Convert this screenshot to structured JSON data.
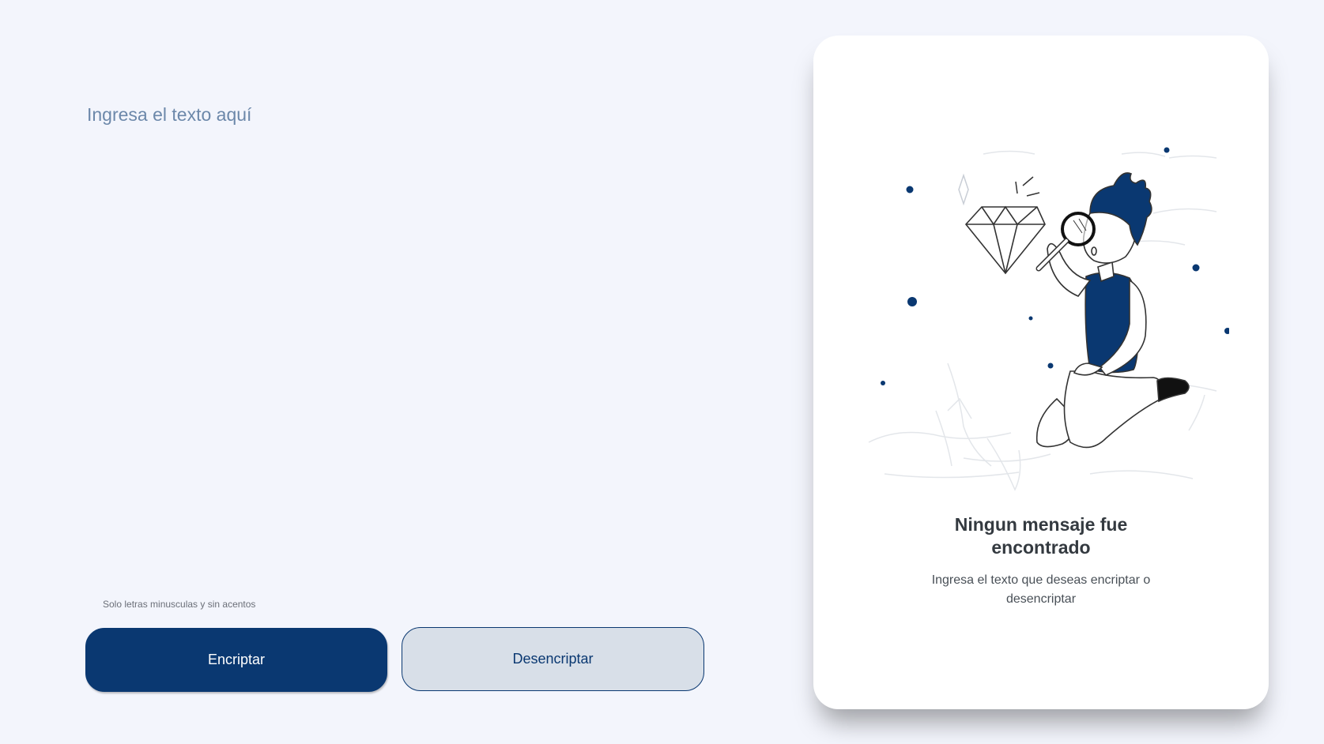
{
  "input": {
    "placeholder": "Ingresa el texto aquí",
    "value": ""
  },
  "hint": {
    "icon": "info-icon",
    "text": "Solo letras minusculas y sin acentos"
  },
  "buttons": {
    "encrypt_label": "Encriptar",
    "decrypt_label": "Desencriptar"
  },
  "result": {
    "illustration": "person-with-magnifying-glass-diamond",
    "title_line1": "Ningun mensaje fue",
    "title_line2": "encontrado",
    "subtitle": "Ingresa el texto que deseas encriptar o desencriptar"
  },
  "colors": {
    "background": "#f3f5fc",
    "primary": "#0a3871",
    "secondary_button": "#d8dfe8",
    "placeholder": "#6c88aa"
  }
}
